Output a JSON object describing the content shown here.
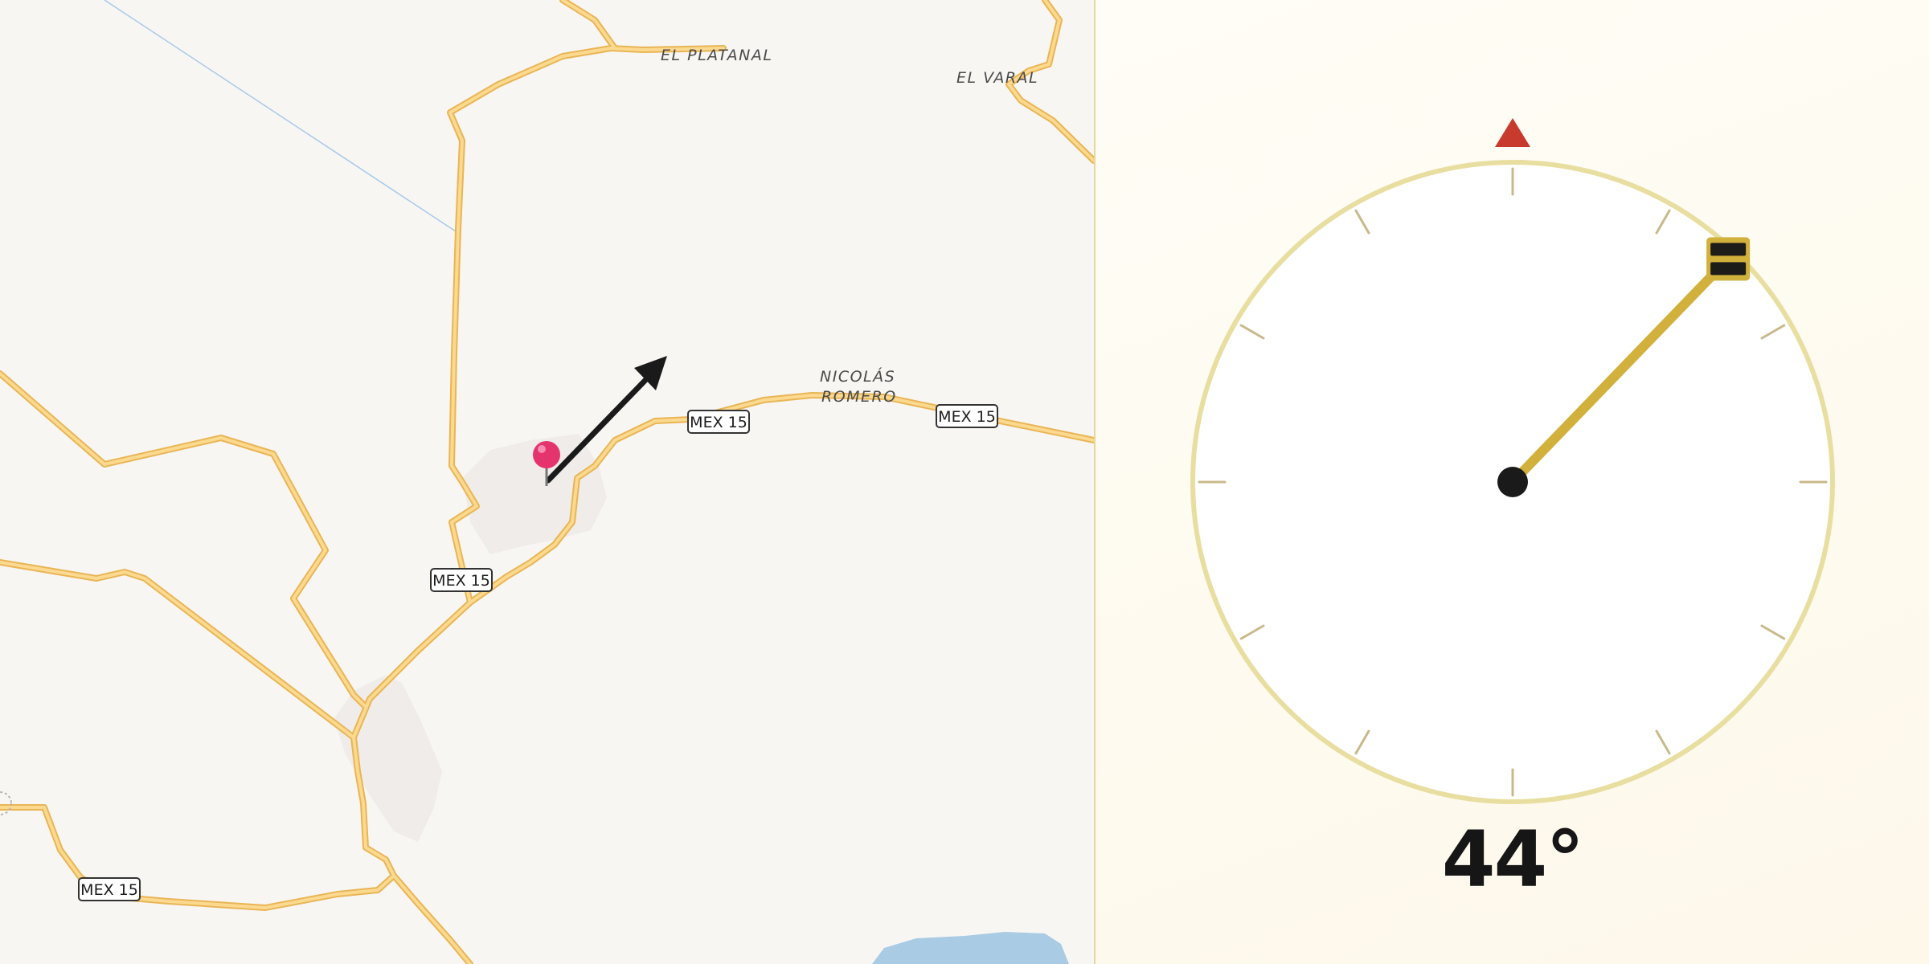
{
  "map": {
    "places": [
      {
        "name": "EL PLATANAL"
      },
      {
        "name": "EL VARAL"
      },
      {
        "name": "NICOLÁS",
        "name2": "ROMERO"
      }
    ],
    "route_shields": [
      "MEX 15",
      "MEX 15",
      "MEX 15",
      "MEX 15"
    ],
    "colors": {
      "background": "#f8f6f3",
      "road": "#f4c56a",
      "road_casing": "#e8b354",
      "urban_area": "#efeceb",
      "water": "#a9cbe4",
      "pin": "#e5336e"
    },
    "marker_icon": "map-pin-icon",
    "direction_icon": "heading-arrow-icon"
  },
  "compass": {
    "heading_deg": 44,
    "heading_text": "44°",
    "north_indicator_icon": "north-triangle-icon",
    "needle_icon": "compass-needle-icon",
    "colors": {
      "ring": "#e8dea0",
      "ticks": "#c9b98a",
      "needle": "#d1b03c",
      "north": "#c8392e",
      "hub": "#1a1a1a"
    }
  }
}
